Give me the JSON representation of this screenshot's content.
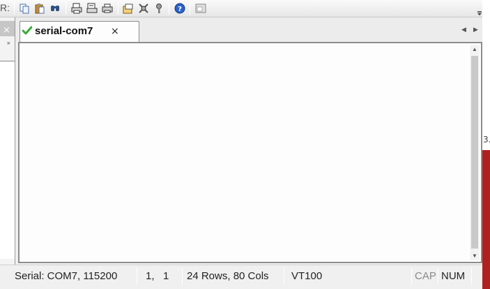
{
  "toolbar": {
    "clipped_label": "R:",
    "buttons": [
      {
        "name": "copy-icon"
      },
      {
        "name": "paste-icon"
      },
      {
        "name": "find-icon"
      },
      {
        "name": "print-icon"
      },
      {
        "name": "print-selection-icon"
      },
      {
        "name": "print-setup-icon"
      },
      {
        "name": "session-options-icon"
      },
      {
        "name": "global-options-icon"
      },
      {
        "name": "keymap-icon"
      },
      {
        "name": "help-icon"
      },
      {
        "name": "window-icon"
      }
    ]
  },
  "tabs": [
    {
      "label": "serial-com7",
      "status_icon": "connected-check-icon",
      "close": "×"
    }
  ],
  "left_panel": {
    "close": "×",
    "expand": "»"
  },
  "right_edge": {
    "digit": "3."
  },
  "status": {
    "connection": "Serial: COM7, 115200",
    "cursor": "1,   1",
    "size": "24 Rows, 80 Cols",
    "emulation": "VT100",
    "caps": "CAP",
    "num": "NUM"
  },
  "colors": {
    "check": "#3aa935",
    "accent_red": "#b02020"
  }
}
